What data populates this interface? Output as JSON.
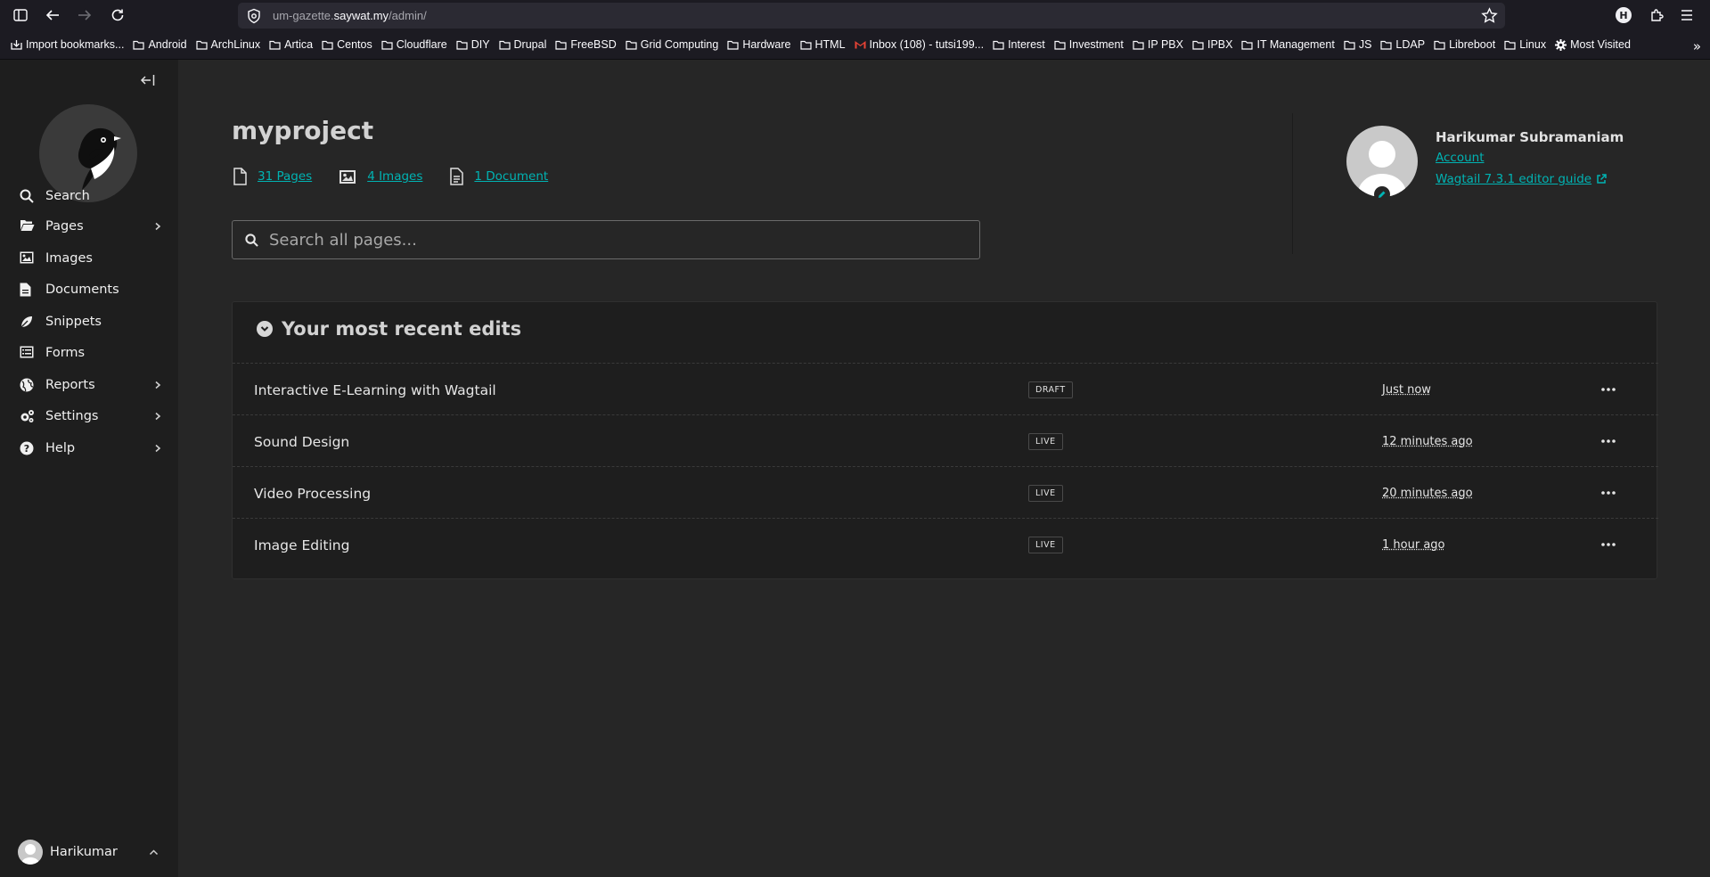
{
  "browser": {
    "url_prefix": "um-gazette.",
    "url_host": "saywat.my",
    "url_path": "/admin/",
    "bookmarks": [
      {
        "label": "Import bookmarks...",
        "icon": "import-icon"
      },
      {
        "label": "Android",
        "icon": "folder-icon"
      },
      {
        "label": "ArchLinux",
        "icon": "folder-icon"
      },
      {
        "label": "Artica",
        "icon": "folder-icon"
      },
      {
        "label": "Centos",
        "icon": "folder-icon"
      },
      {
        "label": "Cloudflare",
        "icon": "folder-icon"
      },
      {
        "label": "DIY",
        "icon": "folder-icon"
      },
      {
        "label": "Drupal",
        "icon": "folder-icon"
      },
      {
        "label": "FreeBSD",
        "icon": "folder-icon"
      },
      {
        "label": "Grid Computing",
        "icon": "folder-icon"
      },
      {
        "label": "Hardware",
        "icon": "folder-icon"
      },
      {
        "label": "HTML",
        "icon": "folder-icon"
      },
      {
        "label": "Inbox (108) - tutsi199...",
        "icon": "gmail-icon"
      },
      {
        "label": "Interest",
        "icon": "folder-icon"
      },
      {
        "label": "Investment",
        "icon": "folder-icon"
      },
      {
        "label": "IP PBX",
        "icon": "folder-icon"
      },
      {
        "label": "IPBX",
        "icon": "folder-icon"
      },
      {
        "label": "IT Management",
        "icon": "folder-icon"
      },
      {
        "label": "JS",
        "icon": "folder-icon"
      },
      {
        "label": "LDAP",
        "icon": "folder-icon"
      },
      {
        "label": "Libreboot",
        "icon": "folder-icon"
      },
      {
        "label": "Linux",
        "icon": "folder-icon"
      },
      {
        "label": "Most Visited",
        "icon": "gear-icon"
      }
    ],
    "profile_initial": "H"
  },
  "sidebar": {
    "items": [
      {
        "label": "Search",
        "icon": "search-icon",
        "has_submenu": false
      },
      {
        "label": "Pages",
        "icon": "folder-open-icon",
        "has_submenu": true
      },
      {
        "label": "Images",
        "icon": "image-icon",
        "has_submenu": false
      },
      {
        "label": "Documents",
        "icon": "document-icon",
        "has_submenu": false
      },
      {
        "label": "Snippets",
        "icon": "snippet-icon",
        "has_submenu": false
      },
      {
        "label": "Forms",
        "icon": "list-icon",
        "has_submenu": false
      },
      {
        "label": "Reports",
        "icon": "globe-icon",
        "has_submenu": true
      },
      {
        "label": "Settings",
        "icon": "cogs-icon",
        "has_submenu": true
      },
      {
        "label": "Help",
        "icon": "help-icon",
        "has_submenu": true
      }
    ],
    "account_name": "Harikumar"
  },
  "main": {
    "site_name": "myproject",
    "summary": {
      "pages": "31 Pages",
      "images": "4 Images",
      "documents": "1 Document"
    },
    "search_placeholder": "Search all pages...",
    "user": {
      "name": "Harikumar Subramaniam",
      "account_link": "Account",
      "guide_link": "Wagtail 7.3.1 editor guide"
    },
    "recent_edits": {
      "heading": "Your most recent edits",
      "rows": [
        {
          "title": "Interactive E-Learning with Wagtail",
          "status": "DRAFT",
          "time": "Just now"
        },
        {
          "title": "Sound Design",
          "status": "LIVE",
          "time": "12 minutes ago"
        },
        {
          "title": "Video Processing",
          "status": "LIVE",
          "time": "20 minutes ago"
        },
        {
          "title": "Image Editing",
          "status": "LIVE",
          "time": "1 hour ago"
        }
      ]
    }
  },
  "colors": {
    "accent": "#00b3b3",
    "sidebar_bg": "#1e1e1e",
    "main_bg": "#262626"
  }
}
